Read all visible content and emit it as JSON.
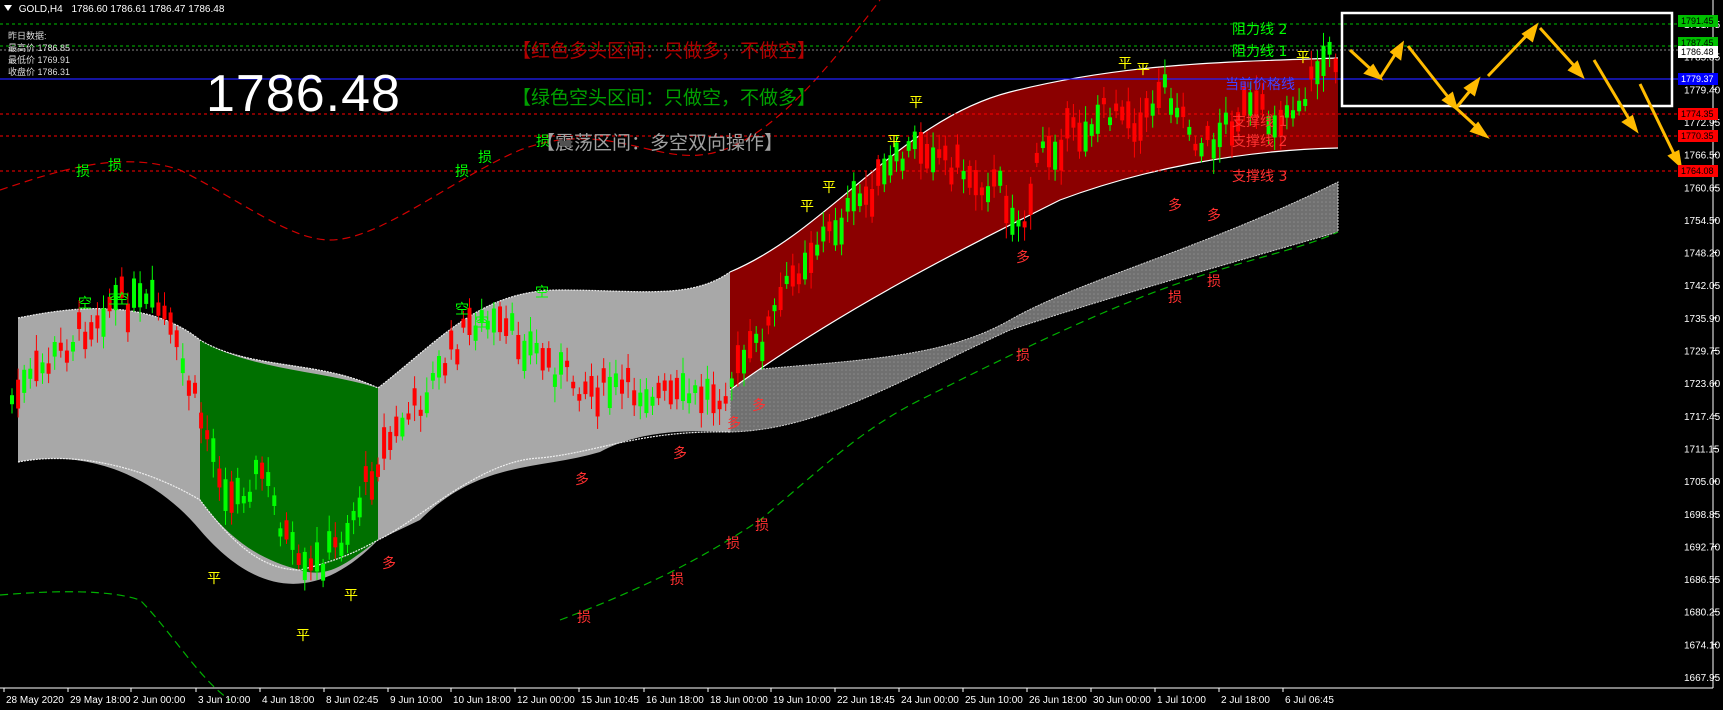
{
  "header": {
    "symbol_tf": "GOLD,H4",
    "ohlc": "1786.60 1786.61 1786.47 1786.48"
  },
  "yesterday": {
    "title": "昨日数据:",
    "high": "最高价 1786.85",
    "low": "最低价 1769.91",
    "close": "收盘价 1786.31"
  },
  "current_price": "1786.48",
  "zones": {
    "bull": "【红色多头区间：只做多，不做空】",
    "bear": "【绿色空头区间：只做空，不做多】",
    "range": "【震荡区间：多空双向操作】"
  },
  "levels": [
    {
      "label": "阻力线 2",
      "color": "#00ff00"
    },
    {
      "label": "阻力线 1",
      "color": "#00ff00"
    },
    {
      "label": "当前价格线",
      "color": "#0000ff"
    },
    {
      "label": "支撑线 1",
      "color": "#ff0000"
    },
    {
      "label": "支撑线 2",
      "color": "#ff0000"
    },
    {
      "label": "支撑线 3",
      "color": "#ff0000"
    }
  ],
  "price_tags": [
    {
      "value": "1791.45",
      "bg": "#00c000",
      "fg": "#000000"
    },
    {
      "value": "1787.45",
      "bg": "#00c000",
      "fg": "#000000"
    },
    {
      "value": "1786.48",
      "bg": "#ffffff",
      "fg": "#000000"
    },
    {
      "value": "1779.37",
      "bg": "#0000ff",
      "fg": "#ffffff"
    },
    {
      "value": "1774.35",
      "bg": "#ff0000",
      "fg": "#000000"
    },
    {
      "value": "1770.35",
      "bg": "#ff0000",
      "fg": "#000000"
    },
    {
      "value": "1764.08",
      "bg": "#ff0000",
      "fg": "#000000"
    }
  ],
  "y_axis": [
    "1791.45",
    "1785.85",
    "1779.40",
    "1772.95",
    "1766.50",
    "1760.65",
    "1754.50",
    "1748.20",
    "1742.05",
    "1735.90",
    "1729.75",
    "1723.60",
    "1717.45",
    "1711.15",
    "1705.00",
    "1698.85",
    "1692.70",
    "1686.55",
    "1680.25",
    "1674.10",
    "1667.95"
  ],
  "x_axis": [
    "28 May 2020",
    "29 May 18:00",
    "2 Jun 00:00",
    "3 Jun 10:00",
    "4 Jun 18:00",
    "8 Jun 02:45",
    "9 Jun 10:00",
    "10 Jun 18:00",
    "12 Jun 00:00",
    "15 Jun 10:45",
    "16 Jun 18:00",
    "18 Jun 00:00",
    "19 Jun 10:00",
    "22 Jun 18:45",
    "24 Jun 00:00",
    "25 Jun 10:00",
    "26 Jun 18:00",
    "30 Jun 00:00",
    "1 Jul 10:00",
    "2 Jul 18:00",
    "6 Jul 06:45"
  ],
  "markers": {
    "kong": "空",
    "ping": "平",
    "duo": "多",
    "sun": "损"
  },
  "colors": {
    "bull_fill": "#8b0000",
    "bear_fill": "#006400",
    "range_fill": "#a0a0a0",
    "up_candle": "#00ff00",
    "down_candle": "#ff0000",
    "arrow": "#ffbb00"
  }
}
